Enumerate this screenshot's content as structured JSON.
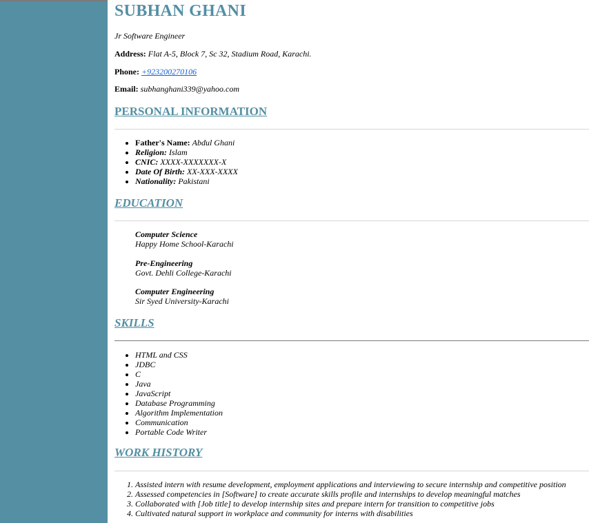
{
  "name": "SUBHAN GHANI",
  "job_title": "Jr Software Engineer",
  "address": {
    "label": "Address:",
    "value": "Flat A-5, Block 7, Sc 32, Stadium Road, Karachi."
  },
  "phone": {
    "label": "Phone:",
    "value": "+923200270106"
  },
  "email": {
    "label": "Email:",
    "value": "subhanghani339@yahoo.com"
  },
  "personal": {
    "heading": "PERSONAL INFORMATION",
    "items": [
      {
        "label": "Father's Name:",
        "value": "Abdul Ghani"
      },
      {
        "label": "Religion:",
        "value": "Islam"
      },
      {
        "label": "CNIC:",
        "value": "XXXX-XXXXXXX-X"
      },
      {
        "label": "Date Of Birth:",
        "value": "XX-XXX-XXXX"
      },
      {
        "label": "Nationality:",
        "value": "Pakistani"
      }
    ]
  },
  "education": {
    "heading": "EDUCATION",
    "items": [
      {
        "degree": "Computer Science",
        "school": "Happy Home School-Karachi"
      },
      {
        "degree": "Pre-Engineering",
        "school": "Govt. Dehli College-Karachi"
      },
      {
        "degree": "Computer Engineering",
        "school": "Sir Syed University-Karachi"
      }
    ]
  },
  "skills": {
    "heading": "SKILLS",
    "items": [
      "HTML and CSS",
      "JDBC",
      "C",
      "Java",
      "JavaScript",
      "Database Programming",
      "Algorithm Implementation",
      "Communication",
      "Portable Code Writer"
    ]
  },
  "work": {
    "heading": "WORK HISTORY",
    "items": [
      "Assisted intern with resume development, employment applications and interviewing to secure internship and competitive position",
      "Assessed competencies in [Software] to create accurate skills profile and internships to develop meaningful matches",
      "Collaborated with [Job title] to develop internship sites and prepare intern for transition to competitive jobs",
      "Cultivated natural support in workplace and community for interns with disabilities"
    ]
  },
  "colors": {
    "accent": "#548fa3",
    "link": "#1a5fd6"
  }
}
